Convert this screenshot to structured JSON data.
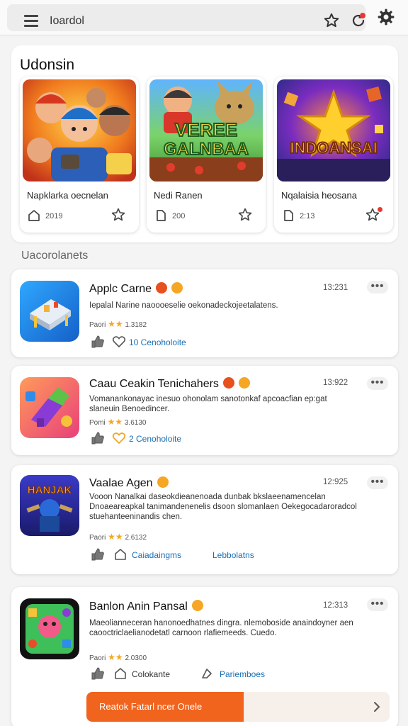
{
  "header": {
    "search_text": "Ioardol",
    "icons": [
      "menu-icon",
      "star-icon",
      "refresh-icon",
      "gear-icon"
    ]
  },
  "featured": {
    "title": "Udonsin",
    "cards": [
      {
        "name": "Napklarka oecnelan",
        "count": "2019"
      },
      {
        "name": "Nedi Ranen",
        "count": "200"
      },
      {
        "name": "Nqalaisia heosana",
        "count": "2:13"
      }
    ],
    "image_text": {
      "card2": [
        "VEREE",
        "GALNBAA"
      ],
      "card3": "INDOANSAI"
    }
  },
  "section_title": "Uacorolanets",
  "list": [
    {
      "title": "Applc Carne",
      "time": "13:231",
      "desc": "Iepalal Narine naoooeselie oekonadeckojeetalatens.",
      "rating": "Paori",
      "rating_value": "1.3182",
      "stars": "★★",
      "actions": [
        "10 Cenoholoite"
      ]
    },
    {
      "title": "Caau Ceakin Tenichahers",
      "time": "13:922",
      "desc": "Vomanankonayac inesuo ohonolam sanotonkaf apcoacfian ep:gat slaneuin Benoedincer.",
      "rating": "Pomi",
      "rating_value": "3.6130",
      "stars": "★★",
      "actions": [
        "2 Cenoholoite"
      ]
    },
    {
      "title": "Vaalae Agen",
      "time": "12:925",
      "desc": "Vooon Nanalkai daseokdieanenoada dunbak bkslaeenamencelan Dnoaeareapkal tanimandenenelis dsoon slomanlaen Oekegocadaroradcol stuehanteeninandis chen.",
      "rating": "Paori",
      "rating_value": "2.6132",
      "stars": "★★",
      "actions": [
        "Caiadaingms",
        "Lebbolatns"
      ]
    },
    {
      "title": "Banlon Anin Pansal",
      "time": "12:313",
      "desc": "Maeolianneceran hanonoedhatnes dingra. nlemoboside anaindoyner aen caooctriclaelianodetatl carnoon rlafiemeeds. Cuedo.",
      "rating": "Paori",
      "rating_value": "2.0300",
      "stars": "★★",
      "actions": [
        "Colokante",
        "Pariemboes"
      ]
    }
  ],
  "list_icon_text": {
    "item3": "HANJAK"
  },
  "cta": {
    "label": "Reatok Fatarl ncer Onele"
  },
  "colors": {
    "accent": "#f0641e",
    "link": "#1a6fb5",
    "star": "#f5a623",
    "badge_red": "#e8501e"
  }
}
